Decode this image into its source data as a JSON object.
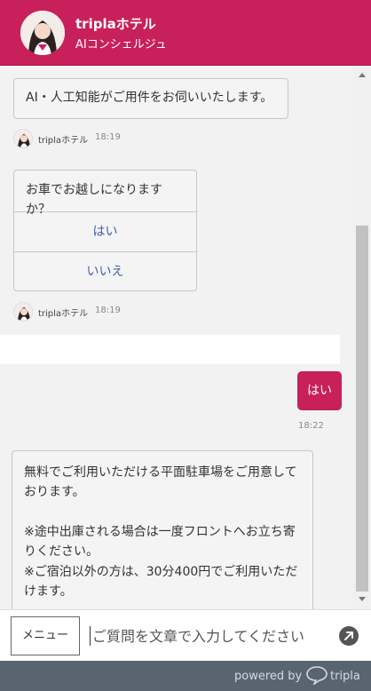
{
  "header": {
    "bot_name": "triplaホテル",
    "bot_subtitle": "AIコンシェルジュ"
  },
  "messages": {
    "m1": {
      "text": "AI・人工知能がご用件をお伺いいたします。",
      "sender": "triplaホテル",
      "time": "18:19"
    },
    "m2": {
      "question": "お車でお越しになりますか？",
      "options": [
        "はい",
        "いいえ"
      ],
      "sender": "triplaホテル",
      "time": "18:19"
    },
    "user": {
      "text": "はい",
      "time": "18:22"
    },
    "m3": {
      "line1": "無料でご利用いただける平面駐車場をご用意しております。",
      "line2": "※途中出庫される場合は一度フロントへお立ち寄りください。",
      "line3": "※ご宿泊以外の方は、30分400円でご利用いただけます。"
    }
  },
  "input": {
    "menu_label": "メニュー",
    "placeholder": "ご質問を文章で入力してください"
  },
  "footer": {
    "powered_by": "powered by",
    "brand": "tripla"
  },
  "colors": {
    "brand": "#c8205a",
    "option_link": "#3b63a8",
    "footer_bg": "#596471"
  }
}
